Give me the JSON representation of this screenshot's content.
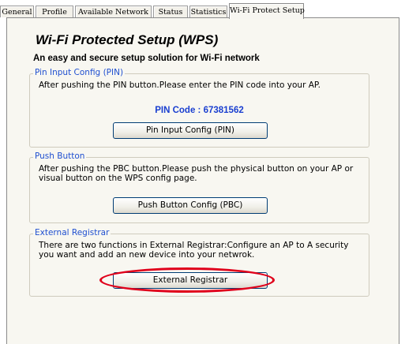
{
  "tabs": [
    {
      "label": "General"
    },
    {
      "label": "Profile"
    },
    {
      "label": "Available Network"
    },
    {
      "label": "Status"
    },
    {
      "label": "Statistics"
    },
    {
      "label": "Wi-Fi Protect Setup"
    }
  ],
  "wps": {
    "title": "Wi-Fi Protected Setup (WPS)",
    "subtitle": "An easy and secure setup solution for Wi-Fi network"
  },
  "pin_group": {
    "legend": "Pin Input Config (PIN)",
    "description": "After pushing the PIN button.Please enter the PIN code into your AP.",
    "pin_code_label": "PIN Code :",
    "pin_code_value": "67381562",
    "button_label": "Pin Input Config (PIN)"
  },
  "pbc_group": {
    "legend": "Push Button",
    "description": "After pushing the PBC button.Please push the physical button on your AP or visual button on the WPS config page.",
    "button_label": "Push Button Config (PBC)"
  },
  "er_group": {
    "legend": "External Registrar",
    "description": "There are two functions in External Registrar:Configure an AP to A security you want and add an new device into your netwrok.",
    "button_label": "External Registrar"
  },
  "colors": {
    "legend_text": "#1f4fd0",
    "pin_code": "#1a3fd0",
    "highlight_ring": "#e0001b",
    "panel_bg": "#f8f7f1"
  }
}
